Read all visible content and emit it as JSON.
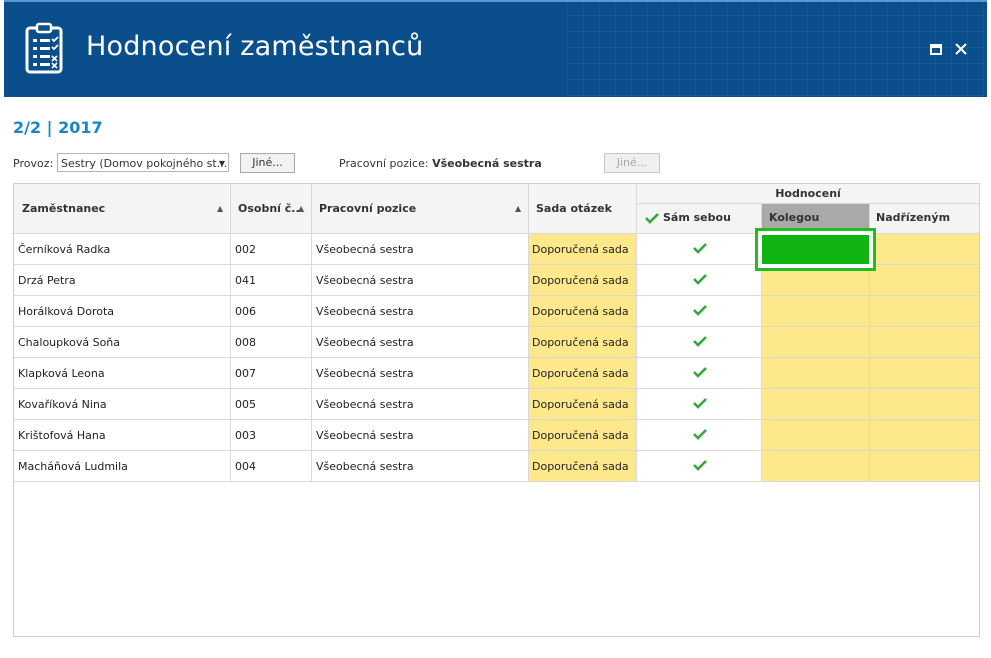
{
  "window": {
    "title": "Hodnocení zaměstnanců"
  },
  "period": "2/2 | 2017",
  "filters": {
    "provoz_label": "Provoz:",
    "provoz_value": "Sestry (Domov pokojného st...",
    "provoz_other_button": "Jiné...",
    "position_label": "Pracovní pozice:",
    "position_value": "Všeobecná sestra",
    "position_other_button": "Jiné..."
  },
  "table": {
    "headers": {
      "employee": "Zaměstnanec",
      "personal_number": "Osobní č...",
      "position": "Pracovní pozice",
      "question_set": "Sada otázek",
      "evaluation_group": "Hodnocení",
      "self": "Sám sebou",
      "colleague": "Kolegou",
      "superior": "Nadřízeným"
    },
    "rows": [
      {
        "employee": "Černíková Radka",
        "number": "002",
        "position": "Všeobecná sestra",
        "set": "Doporučená sada"
      },
      {
        "employee": "Drzá Petra",
        "number": "041",
        "position": "Všeobecná sestra",
        "set": "Doporučená sada"
      },
      {
        "employee": "Horálková Dorota",
        "number": "006",
        "position": "Všeobecná sestra",
        "set": "Doporučená sada"
      },
      {
        "employee": "Chaloupková Soňa",
        "number": "008",
        "position": "Všeobecná sestra",
        "set": "Doporučená sada"
      },
      {
        "employee": "Klapková Leona",
        "number": "007",
        "position": "Všeobecná sestra",
        "set": "Doporučená sada"
      },
      {
        "employee": "Kovaříková Nina",
        "number": "005",
        "position": "Všeobecná sestra",
        "set": "Doporučená sada"
      },
      {
        "employee": "Krištofová Hana",
        "number": "003",
        "position": "Všeobecná sestra",
        "set": "Doporučená sada"
      },
      {
        "employee": "Macháňová Ludmila",
        "number": "004",
        "position": "Všeobecná sestra",
        "set": "Doporučená sada"
      }
    ]
  },
  "colors": {
    "titlebar": "#0a4e8c",
    "accent_blue": "#1a86c8",
    "yellow_cell": "#fde98c",
    "selected_cell": "#11b511",
    "selected_border": "#22bb22",
    "check_green": "#3aa53a"
  },
  "icons": {
    "app": "clipboard-checklist-icon",
    "maximize": "maximize-icon",
    "close": "close-icon",
    "check": "checkmark-icon",
    "sort": "sort-ascending-icon",
    "dropdown": "chevron-down-icon"
  }
}
